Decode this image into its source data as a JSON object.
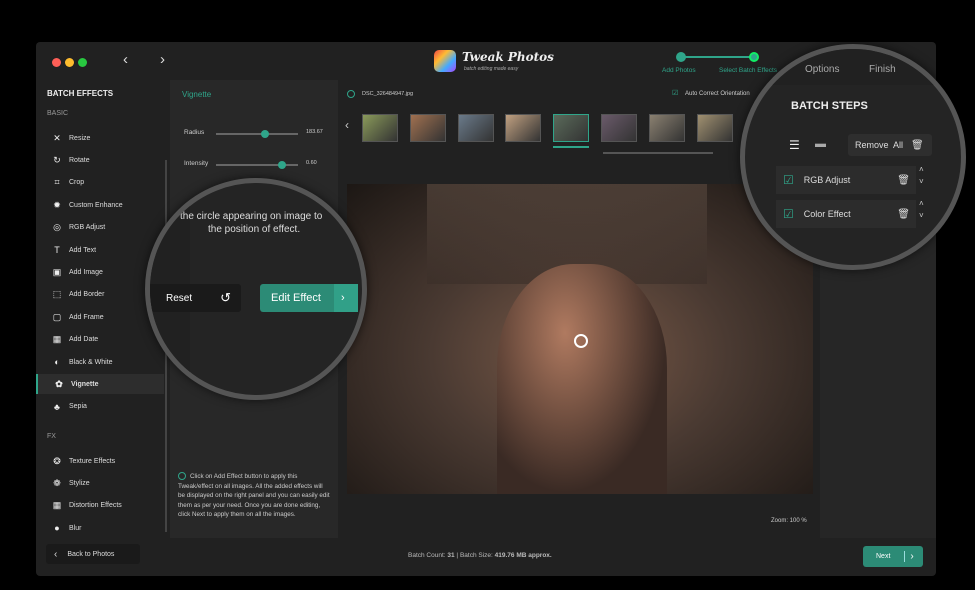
{
  "app": {
    "logo_title": "Tweak Photos",
    "logo_subtitle": "batch editing made easy"
  },
  "steps": [
    {
      "label": "Add Photos"
    },
    {
      "label": "Select Batch Effects"
    },
    {
      "label": "Options"
    },
    {
      "label": "Finish"
    }
  ],
  "sidebar": {
    "title": "BATCH EFFECTS",
    "basic_label": "BASIC",
    "fx_label": "FX",
    "basic": [
      {
        "label": "Resize",
        "icon": "✕"
      },
      {
        "label": "Rotate",
        "icon": "↻"
      },
      {
        "label": "Crop",
        "icon": "⌗"
      },
      {
        "label": "Custom Enhance",
        "icon": "✹"
      },
      {
        "label": "RGB Adjust",
        "icon": "◎"
      },
      {
        "label": "Add Text",
        "icon": "T"
      },
      {
        "label": "Add Image",
        "icon": "▣"
      },
      {
        "label": "Add Border",
        "icon": "⬚"
      },
      {
        "label": "Add Frame",
        "icon": "▢"
      },
      {
        "label": "Add Date",
        "icon": "▦"
      },
      {
        "label": "Black & White",
        "icon": "◐"
      },
      {
        "label": "Vignette",
        "icon": "✿"
      },
      {
        "label": "Sepia",
        "icon": "♣"
      }
    ],
    "fx": [
      {
        "label": "Texture Effects",
        "icon": "❂"
      },
      {
        "label": "Stylize",
        "icon": "❁"
      },
      {
        "label": "Distortion Effects",
        "icon": "▦"
      },
      {
        "label": "Blur",
        "icon": "●"
      }
    ]
  },
  "panel": {
    "title": "Vignette",
    "radius_label": "Radius",
    "radius_value": "183.67",
    "radius_fraction": 0.6,
    "intensity_label": "Intensity",
    "intensity_value": "0.60",
    "intensity_fraction": 0.8,
    "info": "Click on Add Effect button to apply this Tweak/effect on all images. All the added effects will be displayed on the right panel and you can easily edit them as per your need. Once you are done editing, click Next to apply them on all the images."
  },
  "main": {
    "filename": "DSC_326484947.jpg",
    "auto_orient": "Auto Correct Orientation",
    "zoom": "Zoom: 100 %"
  },
  "magnifier": {
    "hint_line1": "the circle appearing on image to",
    "hint_line2": "the position of effect.",
    "reset": "Reset",
    "edit_effect": "Edit Effect"
  },
  "batch_steps": {
    "title": "BATCH STEPS",
    "remove_all": "Remove  All",
    "items": [
      {
        "label": "RGB Adjust"
      },
      {
        "label": "Color Effect"
      }
    ]
  },
  "bottom": {
    "back": "Back to Photos",
    "count_label": "Batch Count:",
    "count": "31",
    "size_label": "Batch Size:",
    "size": "419.76 MB approx.",
    "next": "Next"
  },
  "colors": {
    "accent": "#2fa58a"
  }
}
